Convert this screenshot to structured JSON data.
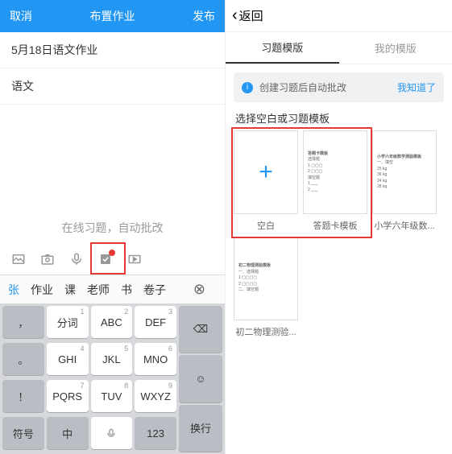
{
  "left": {
    "cancel": "取消",
    "title": "布置作业",
    "publish": "发布",
    "date_line": "5月18日语文作业",
    "subject": "语文",
    "placeholder": "在线习题，自动批改",
    "candidates": [
      "张",
      "作业",
      "课",
      "老师",
      "书",
      "卷子"
    ],
    "keys": {
      "r1": [
        "，",
        "分词",
        "ABC",
        "DEF"
      ],
      "r2": [
        "。",
        "GHI",
        "JKL",
        "MNO"
      ],
      "r3": [
        "！",
        "PQRS",
        "TUV",
        "WXYZ"
      ],
      "r4": [
        "符号",
        "中",
        "",
        "123"
      ],
      "nums": {
        "abc": "2",
        "def": "3",
        "ghi": "4",
        "jkl": "5",
        "mno": "6",
        "pqrs": "7",
        "tuv": "8",
        "wxyz": "9",
        "fc": "1"
      },
      "del": "⌫",
      "emoji": "☺",
      "enter": "换行"
    }
  },
  "right": {
    "back": "返回",
    "tabs": [
      "习题模版",
      "我的模版"
    ],
    "notice": "创建习题后自动批改",
    "notice_ok": "我知道了",
    "section": "选择空白或习题模板",
    "tpl_blank": "空白",
    "tpl_answer": "答题卡模板",
    "tpl_math": "小学六年级数...",
    "tpl_math_full": "小学六年级数学测验模板",
    "tpl_phys": "初二物理测验...",
    "tpl_phys_full": "初二物理测验模板"
  }
}
